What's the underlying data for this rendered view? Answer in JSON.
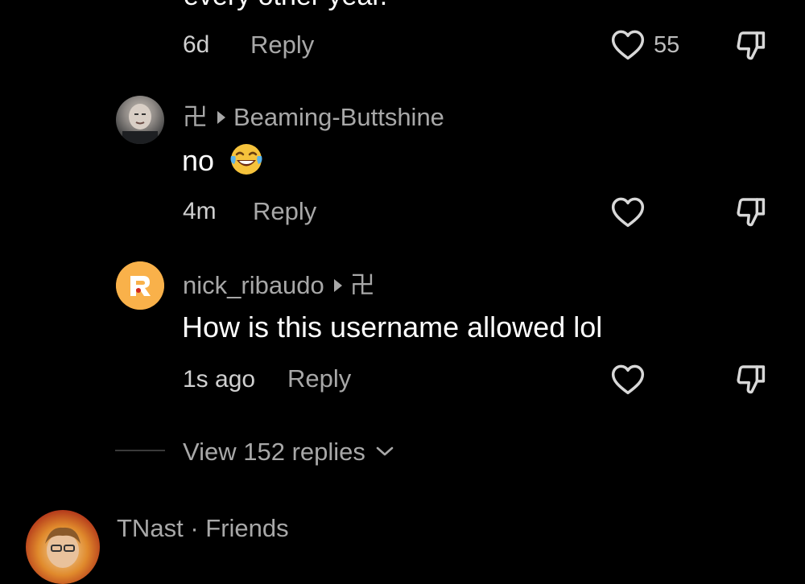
{
  "comments": [
    {
      "body_cropped": "every other year.",
      "time": "6d",
      "reply_label": "Reply",
      "likes": "55"
    },
    {
      "author": "Beaming-Buttshine",
      "reply_to": "卍",
      "body": "no",
      "emoji": "😂",
      "time": "4m",
      "reply_label": "Reply"
    },
    {
      "author": "nick_ribaudo",
      "reply_to": "卍",
      "body": "How is this username allowed lol",
      "time": "1s ago",
      "reply_label": "Reply"
    }
  ],
  "view_replies": "View 152 replies",
  "next_comment": {
    "author": "TNast",
    "separator": "·",
    "tag": "Friends"
  },
  "icons": {
    "like": "heart-icon",
    "dislike": "thumbs-down-icon",
    "expand": "chevron-down-icon",
    "reply_caret": "caret-right-icon"
  },
  "colors": {
    "background": "#000000",
    "primary_text": "#ffffff",
    "secondary_text": "#a8a8a8"
  }
}
